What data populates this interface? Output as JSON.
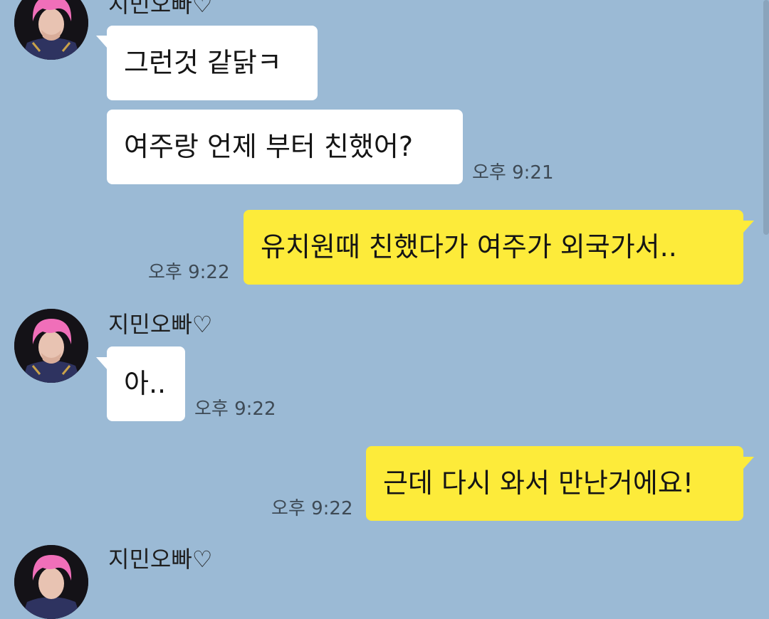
{
  "contact": {
    "name": "지민오빠♡",
    "avatar_icon": "profile-photo"
  },
  "messages": [
    {
      "from": "them",
      "text": "그런것 같닭ㅋ"
    },
    {
      "from": "them",
      "text": "여주랑 언제 부터 친했어?",
      "time": "오후 9:21"
    },
    {
      "from": "me",
      "text": "유치원때 친했다가 여주가 외국가서..",
      "time": "오후 9:22"
    },
    {
      "from": "them",
      "text": "아..",
      "time": "오후 9:22"
    },
    {
      "from": "me",
      "text": "근데 다시 와서 만난거에요!",
      "time": "오후 9:22"
    }
  ],
  "colors": {
    "background": "#9bbad5",
    "incoming_bubble": "#ffffff",
    "outgoing_bubble": "#fdeb3a"
  }
}
